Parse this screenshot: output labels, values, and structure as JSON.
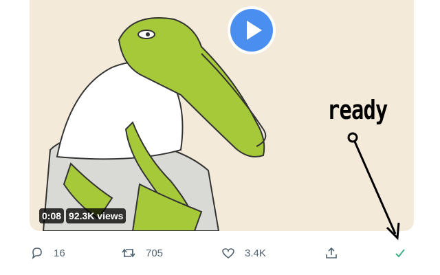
{
  "video": {
    "timestamp": "0:08",
    "views": "92.3K views",
    "accent_color": "#4a8ef0"
  },
  "annotation": {
    "label": "ready"
  },
  "actions": {
    "reply": {
      "icon": "reply-icon",
      "count": "16"
    },
    "retweet": {
      "icon": "retweet-icon",
      "count": "705"
    },
    "like": {
      "icon": "heart-icon",
      "count": "3.4K"
    },
    "share": {
      "icon": "share-icon"
    },
    "status": {
      "icon": "checkmark-icon",
      "color": "#2aa876"
    }
  }
}
